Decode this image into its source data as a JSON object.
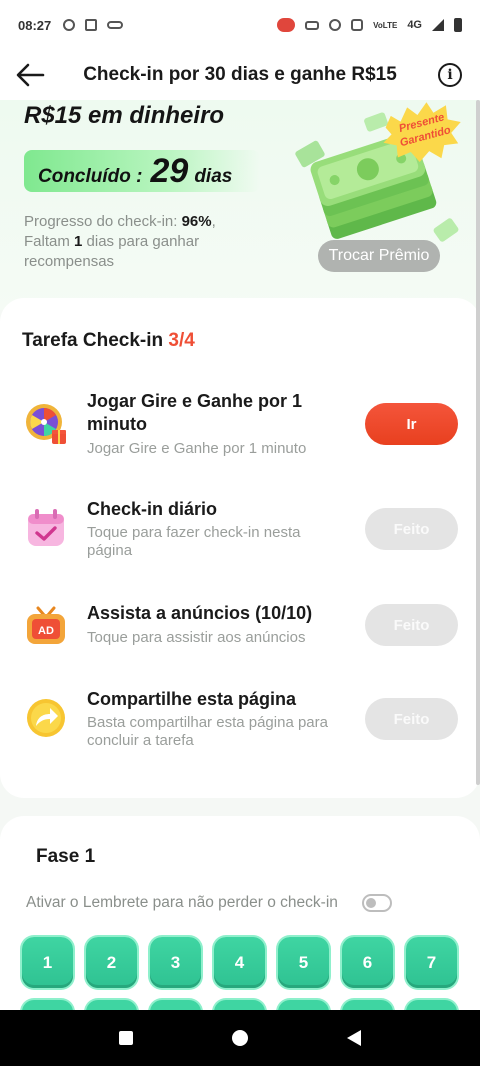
{
  "status_bar": {
    "time": "08:27",
    "network": "4G",
    "volte": "VoLTE"
  },
  "app_bar": {
    "title": "Check-in por 30 dias e ganhe R$15",
    "back_icon": "arrow-left-icon",
    "info_icon": "info-icon"
  },
  "hero": {
    "title": "R$15 em dinheiro",
    "done_label": "Concluído :",
    "done_days": "29",
    "done_unit": "dias",
    "progress_label": "Progresso do check-in: ",
    "progress_value": "96%",
    "progress_comma": ",",
    "remaining_prefix": "Faltam ",
    "remaining_value": "1",
    "remaining_suffix": " dias para ganhar recompensas",
    "badge_line1": "Presente",
    "badge_line2": "Garantido",
    "swap_button": "Trocar Prêmio",
    "progress_fraction": 0.96
  },
  "tasks": {
    "header_label": "Tarefa Check-in ",
    "header_count": "3/4",
    "items": [
      {
        "title": "Jogar Gire e Ganhe por 1 minuto",
        "desc": "Jogar Gire e Ganhe por 1 minuto",
        "button": "Ir",
        "icon": "prize-wheel-icon"
      },
      {
        "title": "Check-in diário",
        "desc": "Toque para fazer check-in nesta página",
        "button": "Feito",
        "icon": "calendar-check-icon"
      },
      {
        "title": "Assista a anúncios  (10/10)",
        "desc": "Toque para assistir aos anúncios",
        "button": "Feito",
        "icon": "ad-tv-icon"
      },
      {
        "title": "Compartilhe esta página",
        "desc": "Basta compartilhar esta página para concluir a tarefa",
        "button": "Feito",
        "icon": "share-arrow-icon"
      }
    ]
  },
  "phase": {
    "title": "Fase 1",
    "reminder": "Ativar o Lembrete para não perder o check-in",
    "reminder_on": false,
    "days": [
      "1",
      "2",
      "3",
      "4",
      "5",
      "6",
      "7"
    ]
  },
  "colors": {
    "accent_red": "#ef4f36",
    "done_green": "#7fe88f",
    "day_green": "#3fd5a2",
    "done_button_gray": "#e4e4e4"
  }
}
